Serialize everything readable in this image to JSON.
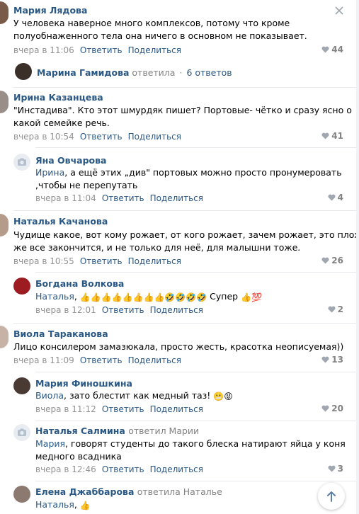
{
  "colors": {
    "link": "#2a5885",
    "meta": "#939393",
    "divider": "#e7e8ec",
    "accent_like": "#828282"
  },
  "comments": [
    {
      "name": "Мария Лядова",
      "text1": "У человека наверное много комплексов, потому что кроме",
      "text2": "полуобнаженного тела она ничего в основном не показывает.",
      "time": "вчера в 11:06",
      "reply": "Ответить",
      "share": "Поделиться",
      "likes": "44"
    },
    {
      "name": "Ирина Казанцева",
      "text1": "\"Инстадива\". Кто этот шмурдяк пишет? Портовые- чётко и сразу ясно о",
      "text2": "какой семейке речь.",
      "time": "вчера в 10:54",
      "reply": "Ответить",
      "share": "Поделиться",
      "likes": "41"
    },
    {
      "name": "Яна Овчарова",
      "addr": "Ирина",
      "text1": ", а ещё этих „див\" портовых можно просто пронумеровать",
      "text2": ",чтобы не перепутать",
      "time": "вчера в 11:04",
      "reply": "Ответить",
      "share": "Поделиться",
      "likes": "4"
    },
    {
      "name": "Наталья Качанова",
      "text1": "Чудище какое, вот кому рожает, от кого рожает, зачем рожает, это плохо",
      "text2": "же все закончится, и не только для неё, для малышни тоже.",
      "time": "вчера в 10:55",
      "reply": "Ответить",
      "share": "Поделиться",
      "likes": "26"
    },
    {
      "name": "Богдана Волкова",
      "addr": "Наталья",
      "text1": ",",
      "text_end": "Супер",
      "time": "вчера в 12:01",
      "reply": "Ответить",
      "share": "Поделиться",
      "likes": "2"
    },
    {
      "name": "Виола Тараканова",
      "text1": "Лицо консилером замазюкала, просто жесть, красотка неописуемая))",
      "time": "вчера в 11:09",
      "reply": "Ответить",
      "share": "Поделиться",
      "likes": "13"
    },
    {
      "name": "Мария Финошкина",
      "addr": "Виола",
      "text1": ", зато блестит как медный таз!",
      "time": "вчера в 11:12",
      "reply": "Ответить",
      "share": "Поделиться",
      "likes": "20"
    },
    {
      "name": "Наталья Салмина",
      "replied": "ответил Марии",
      "addr": "Мария",
      "text1": ", говорят студенты до такого блеска натирают яйца у коня",
      "text2": "медного всадника",
      "time": "вчера в 12:46",
      "reply": "Ответить",
      "share": "Поделиться",
      "likes": "3"
    },
    {
      "name": "Елена Джаббарова",
      "replied": "ответила Наталье",
      "addr": "Наталья",
      "text1": ","
    }
  ],
  "thread_more": {
    "name": "Марина Гамидова",
    "replied": "ответила",
    "count": "6 ответов"
  },
  "icons": {
    "close": "close-icon",
    "like": "heart-icon",
    "scroll_top": "arrow-up-icon",
    "camera": "camera-placeholder-icon"
  }
}
